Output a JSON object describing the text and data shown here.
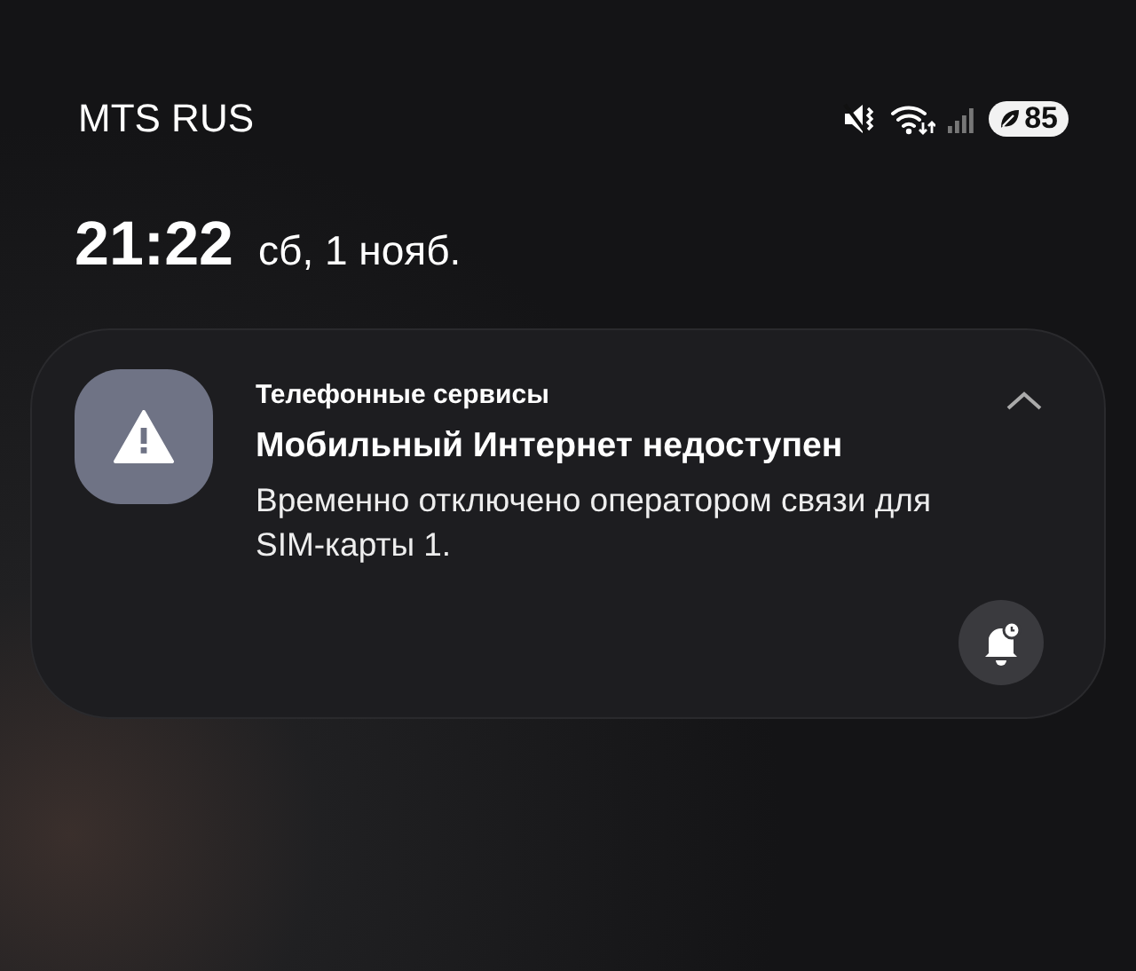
{
  "status_bar": {
    "carrier": "MTS RUS",
    "battery": "85"
  },
  "lock_clock": {
    "time": "21:22",
    "date": "сб, 1 нояб."
  },
  "notification": {
    "app": "Телефонные сервисы",
    "title": "Мобильный Интернет недоступен",
    "body": "Временно отключено оператором связи для SIM-карты 1.",
    "expanded": true
  }
}
